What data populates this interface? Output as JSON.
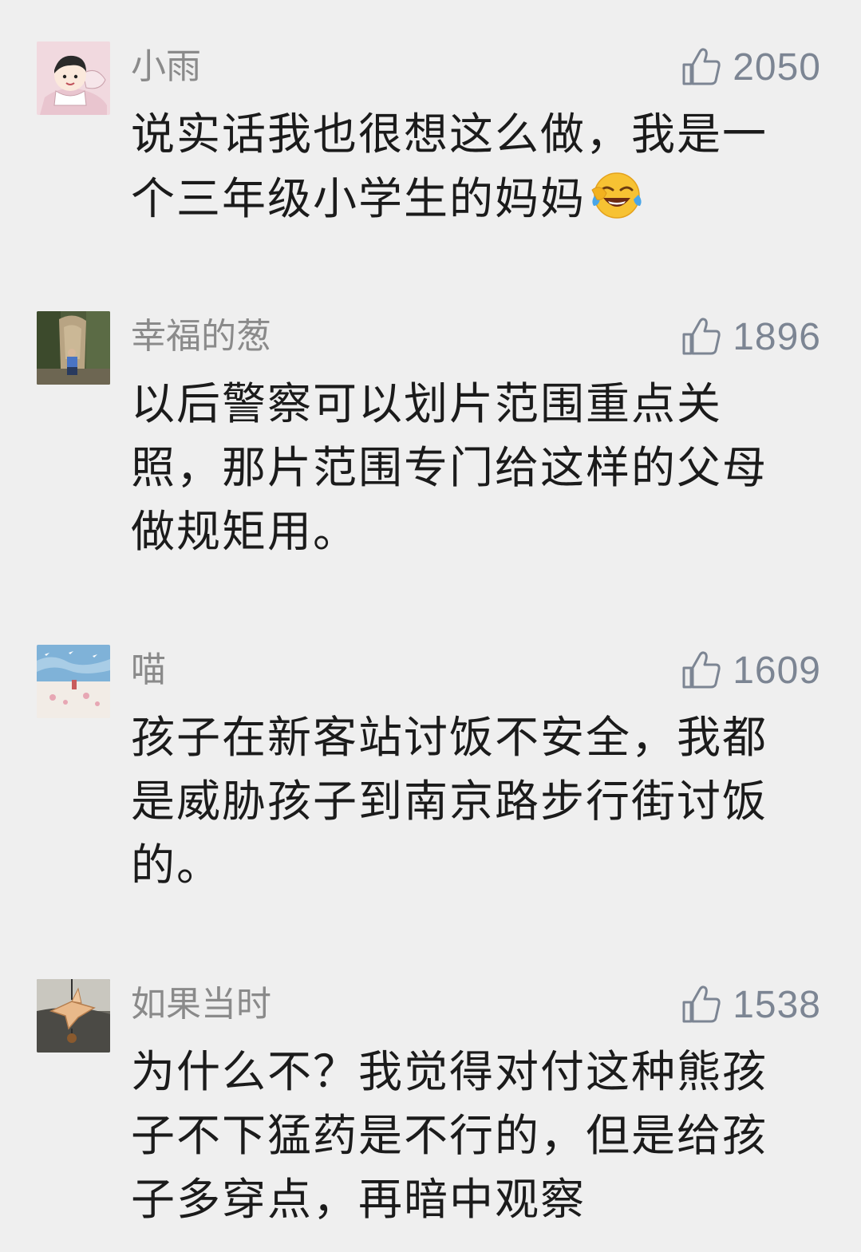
{
  "comments": [
    {
      "username": "小雨",
      "likes": "2050",
      "lines": [
        "说实话我也很想这么做，我是一",
        "个三年级小学生的妈妈"
      ],
      "emoji": "crying-laughing-emoji",
      "avatar": "cartoon-child-avatar"
    },
    {
      "username": "幸福的葱",
      "likes": "1896",
      "lines": [
        "以后警察可以划片范围重点关",
        "照，那片范围专门给这样的父母",
        "做规矩用。"
      ],
      "avatar": "photo-person-at-sculpture-avatar"
    },
    {
      "username": "喵",
      "likes": "1609",
      "lines": [
        "孩子在新客站讨饭不安全，我都",
        "是威胁孩子到南京路步行街讨饭",
        "的。"
      ],
      "avatar": "painted-sky-avatar"
    },
    {
      "username": "如果当时",
      "likes": "1538",
      "lines": [
        "为什么不？我觉得对付这种熊孩",
        "子不下猛药是不行的，但是给孩",
        "子多穿点，再暗中观察"
      ],
      "avatar": "paper-crane-ornament-avatar"
    }
  ],
  "icons": {
    "like": "thumbs-up-icon"
  },
  "colors": {
    "background": "#efefef",
    "username": "#8a8a8a",
    "like": "#7c8593",
    "text": "#1b1b1b"
  }
}
